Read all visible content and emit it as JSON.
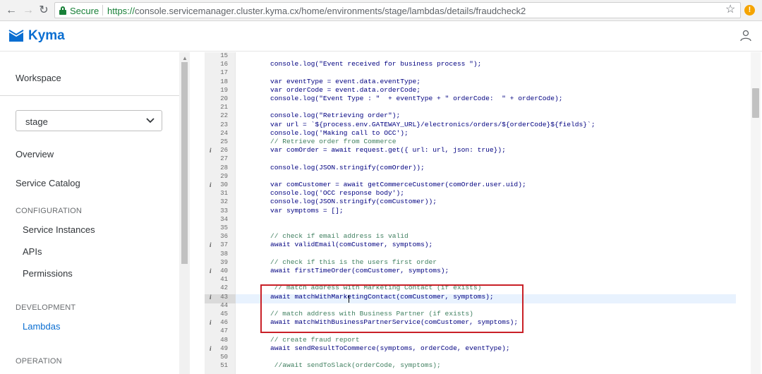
{
  "browser": {
    "secure_label": "Secure",
    "url_protocol": "https://",
    "url_rest": "console.servicemanager.cluster.kyma.cx/home/environments/stage/lambdas/details/fraudcheck2",
    "warning_badge": "!"
  },
  "header": {
    "logo_text": "Kyma"
  },
  "sidebar": {
    "workspace": "Workspace",
    "environment": "stage",
    "overview": "Overview",
    "service_catalog": "Service Catalog",
    "configuration_heading": "CONFIGURATION",
    "service_instances": "Service Instances",
    "apis": "APIs",
    "permissions": "Permissions",
    "development_heading": "DEVELOPMENT",
    "lambdas": "Lambdas",
    "operation_heading": "OPERATION"
  },
  "editor": {
    "lines": [
      {
        "n": "15",
        "info": false,
        "text": ""
      },
      {
        "n": "16",
        "info": false,
        "text": "console.log(\"Event received for business process \");"
      },
      {
        "n": "17",
        "info": false,
        "text": ""
      },
      {
        "n": "18",
        "info": false,
        "text": "var eventType = event.data.eventType;"
      },
      {
        "n": "19",
        "info": false,
        "text": "var orderCode = event.data.orderCode;"
      },
      {
        "n": "20",
        "info": false,
        "text": "console.log(\"Event Type : \"  + eventType + \" orderCode:  \" + orderCode);"
      },
      {
        "n": "21",
        "info": false,
        "text": ""
      },
      {
        "n": "22",
        "info": false,
        "text": "console.log(\"Retrieving order\");"
      },
      {
        "n": "23",
        "info": false,
        "text": "var url = `${process.env.GATEWAY_URL}/electronics/orders/${orderCode}${fields}`;"
      },
      {
        "n": "24",
        "info": false,
        "text": "console.log('Making call to OCC');"
      },
      {
        "n": "25",
        "info": false,
        "text": "// Retrieve order from Commerce"
      },
      {
        "n": "26",
        "info": true,
        "text": "var comOrder = await request.get({ url: url, json: true});"
      },
      {
        "n": "27",
        "info": false,
        "text": ""
      },
      {
        "n": "28",
        "info": false,
        "text": "console.log(JSON.stringify(comOrder));"
      },
      {
        "n": "29",
        "info": false,
        "text": ""
      },
      {
        "n": "30",
        "info": true,
        "text": "var comCustomer = await getCommerceCustomer(comOrder.user.uid);"
      },
      {
        "n": "31",
        "info": false,
        "text": "console.log('OCC response body');"
      },
      {
        "n": "32",
        "info": false,
        "text": "console.log(JSON.stringify(comCustomer));"
      },
      {
        "n": "33",
        "info": false,
        "text": "var symptoms = [];"
      },
      {
        "n": "34",
        "info": false,
        "text": ""
      },
      {
        "n": "35",
        "info": false,
        "text": ""
      },
      {
        "n": "36",
        "info": false,
        "text": "// check if email address is valid"
      },
      {
        "n": "37",
        "info": true,
        "text": "await validEmail(comCustomer, symptoms);"
      },
      {
        "n": "38",
        "info": false,
        "text": ""
      },
      {
        "n": "39",
        "info": false,
        "text": "// check if this is the users first order"
      },
      {
        "n": "40",
        "info": true,
        "text": "await firstTimeOrder(comCustomer, symptoms);"
      },
      {
        "n": "41",
        "info": false,
        "text": ""
      },
      {
        "n": "42",
        "info": false,
        "text": " // match address with Marketing Contact (if exists)"
      },
      {
        "n": "43",
        "info": true,
        "text": "await matchWithMarketingContact(comCustomer, symptoms);"
      },
      {
        "n": "44",
        "info": false,
        "text": ""
      },
      {
        "n": "45",
        "info": false,
        "text": "// match address with Business Partner (if exists)"
      },
      {
        "n": "46",
        "info": true,
        "text": "await matchWithBusinessPartnerService(comCustomer, symptoms);"
      },
      {
        "n": "47",
        "info": false,
        "text": ""
      },
      {
        "n": "48",
        "info": false,
        "text": "// create fraud report"
      },
      {
        "n": "49",
        "info": true,
        "text": "await sendResultToCommerce(symptoms, orderCode, eventType);"
      },
      {
        "n": "50",
        "info": false,
        "text": ""
      },
      {
        "n": "51",
        "info": false,
        "text": " //await sendToSlack(orderCode, symptoms);"
      }
    ]
  },
  "icons": {
    "back": "back-arrow-icon",
    "forward": "forward-arrow-icon",
    "reload": "reload-icon",
    "lock": "lock-icon",
    "star": "star-icon",
    "warning": "warning-icon",
    "logo": "kyma-logo-icon",
    "user": "user-icon",
    "chevron": "chevron-down-icon",
    "info": "info-icon"
  },
  "colors": {
    "accent": "#0a6ed1",
    "secure": "#188038",
    "highlight_box": "#c92027",
    "comment": "#3f7f5f",
    "code": "#000080"
  }
}
